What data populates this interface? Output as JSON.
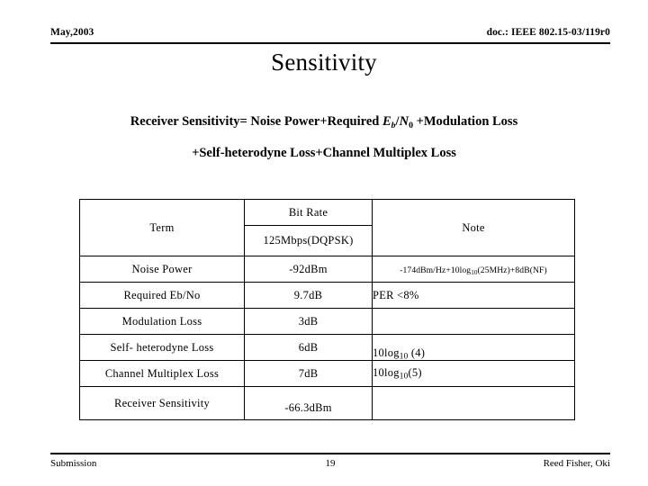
{
  "header": {
    "date": "May,2003",
    "doc_id": "doc.: IEEE 802.15-03/119r0"
  },
  "title": "Sensitivity",
  "equation": {
    "line1_pre": "Receiver Sensitivity= Noise Power+Required ",
    "line1_eb": "E",
    "line1_eb_sub": "b",
    "line1_slash": "/",
    "line1_n": "N",
    "line1_n_sub": "0",
    "line1_post": " +Modulation Loss",
    "line2": "+Self-heterodyne Loss+Channel Multiplex Loss"
  },
  "table": {
    "headers": {
      "term": "Term",
      "bit_rate": "Bit Rate",
      "bit_rate_value": "125Mbps(DQPSK)",
      "note": "Note"
    },
    "rows": [
      {
        "term": "Noise Power",
        "value": "-92dBm",
        "note_pre": "-174dBm/Hz+10log",
        "note_sub": "10",
        "note_post": "(25MHz)+8dB(NF)",
        "note_style": "formula"
      },
      {
        "term": "Required Eb/No",
        "value": "9.7dB",
        "note": "PER <8%",
        "note_style": "plain-left"
      },
      {
        "term": "Modulation Loss",
        "value": "3dB",
        "note": "",
        "note_style": "empty"
      },
      {
        "term": "Self- heterodyne Loss",
        "value": "6dB",
        "note_pre": "10log",
        "note_sub": "10",
        "note_post": " (4)",
        "note_style": "log-down"
      },
      {
        "term": "Channel Multiplex Loss",
        "value": "7dB",
        "note_pre": "10log",
        "note_sub": "10",
        "note_post": "(5)",
        "note_style": "log"
      },
      {
        "term": "Receiver Sensitivity",
        "value": "-66.3dBm",
        "note": "",
        "note_style": "empty"
      }
    ]
  },
  "footer": {
    "left": "Submission",
    "page": "19",
    "right": "Reed Fisher, Oki"
  }
}
